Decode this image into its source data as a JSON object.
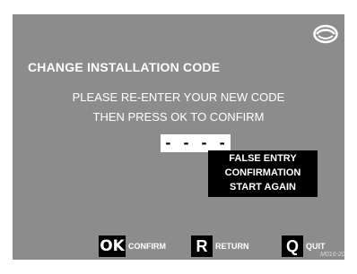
{
  "screen": {
    "title": "CHANGE INSTALLATION CODE",
    "instruction_line1": "PLEASE RE-ENTER YOUR NEW CODE",
    "instruction_line2": "THEN PRESS OK TO CONFIRM",
    "logo_icon": "brand-logo-icon"
  },
  "code_field": {
    "value": "- - - -"
  },
  "error": {
    "line1": "FALSE ENTRY",
    "line2": "CONFIRMATION",
    "line3": "START AGAIN"
  },
  "keys": {
    "ok": {
      "cap": "OK",
      "label": "CONFIRM"
    },
    "r": {
      "cap": "R",
      "label": "RETURN"
    },
    "q": {
      "cap": "Q",
      "label": "QUIT"
    }
  },
  "footer": {
    "model_code": "M016-20"
  },
  "colors": {
    "screen_background": "#8c8c8c",
    "text": "#ffffff",
    "error_background": "#000000",
    "key_background": "#000000"
  }
}
